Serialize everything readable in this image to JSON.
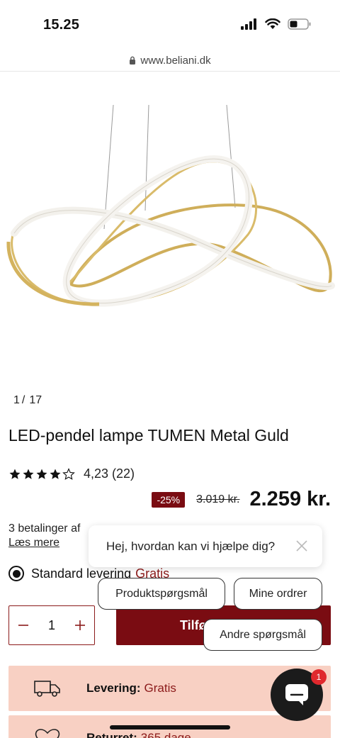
{
  "status_bar": {
    "time": "15.25"
  },
  "browser": {
    "url": "www.beliani.dk"
  },
  "gallery": {
    "current": "1",
    "separator": "/",
    "total": "17"
  },
  "product": {
    "title": "LED-pendel lampe TUMEN Metal Guld",
    "rating": 4.23,
    "rating_text": "4,23 (22)",
    "discount": "-25%",
    "old_price": "3.019 kr.",
    "new_price": "2.259 kr.",
    "installments_text": "3 betalinger af",
    "read_more": "Læs mere"
  },
  "delivery": {
    "label": "Standard levering",
    "price": "Gratis",
    "selected": true
  },
  "cart": {
    "quantity": "1",
    "add_label": "Tilføj"
  },
  "info_cards": [
    {
      "label": "Levering:",
      "value": "Gratis",
      "icon": "truck-icon"
    },
    {
      "label": "Returret:",
      "value": "365 dage",
      "icon": "heart-365-icon"
    }
  ],
  "chat": {
    "greeting": "Hej, hvordan kan vi hjælpe dig?",
    "quick_replies": [
      "Produktspørgsmål",
      "Mine ordrer",
      "Andre spørgsmål"
    ],
    "badge_count": "1"
  },
  "colors": {
    "brand_red": "#7a0c12",
    "accent_text": "#8b1a1a",
    "info_card_bg": "#f8d0c3",
    "chat_dark": "#1b1b1b",
    "badge_red": "#e0282d"
  }
}
